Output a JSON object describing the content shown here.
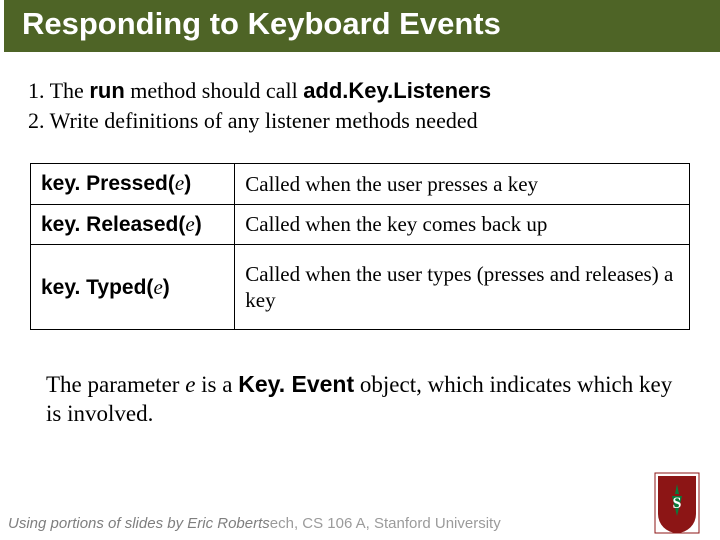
{
  "title": "Responding to Keyboard Events",
  "steps": {
    "one_prefix": "1. The ",
    "one_code1": "run",
    "one_mid": " method should call ",
    "one_code2": "add.Key.Listeners",
    "two": "2. Write definitions of any listener methods needed"
  },
  "table": {
    "rows": [
      {
        "method": "key. Pressed(",
        "param": "e",
        "close": ")",
        "desc": "Called when the user presses a key"
      },
      {
        "method": "key. Released(",
        "param": "e",
        "close": ")",
        "desc": "Called when the key comes back up"
      },
      {
        "method": "key. Typed(",
        "param": "e",
        "close": ")",
        "desc": "Called when the user types (presses and releases) a key"
      }
    ]
  },
  "paragraph": {
    "pre": "The parameter ",
    "param": "e",
    "mid": " is a ",
    "code": "Key. Event",
    "post": " object, which indicates which key is involved."
  },
  "footer": {
    "credit": "Using portions of slides by Eric Roberts",
    "course_overlap": "ech, CS 106 A, Stanford University"
  }
}
